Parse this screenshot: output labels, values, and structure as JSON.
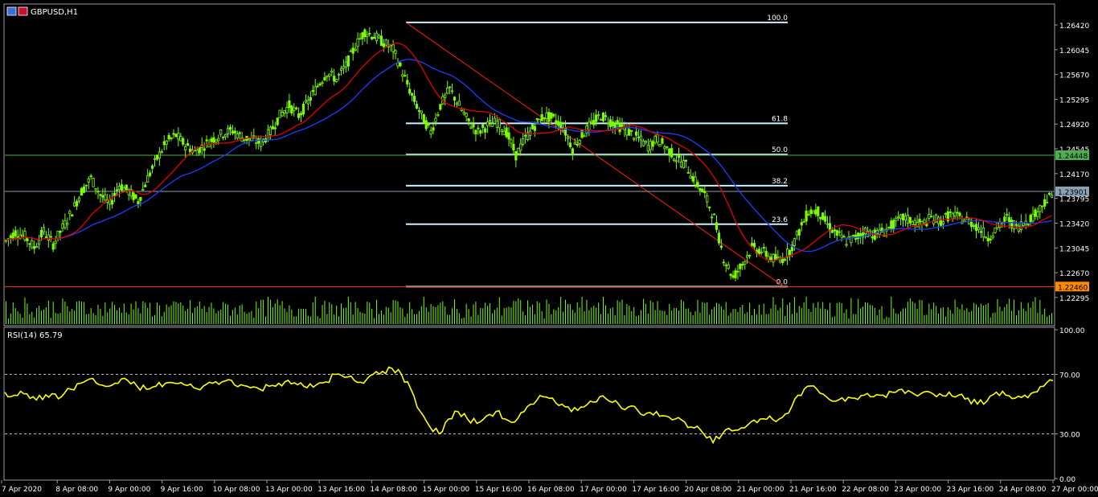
{
  "symbol_label": "GBPUSD,H1",
  "colors": {
    "candle": "#7CFC00",
    "ma_fast": "#e00000",
    "ma_slow": "#1e3cff",
    "fib": "#c6f2ff",
    "rsi": "#ffff00",
    "current_price_line": "#8aa0b4",
    "green_line": "#4caf50",
    "red_line": "#ff3b1f",
    "trend_line": "#ff2000"
  },
  "chart_data": [
    {
      "type": "candlestick",
      "title": "GBPUSD,H1",
      "ylim": [
        1.2205,
        1.267
      ],
      "price_ticks": [
        "1.26420",
        "1.26045",
        "1.25670",
        "1.25295",
        "1.24920",
        "1.24545",
        "1.24170",
        "1.23795",
        "1.23420",
        "1.23045",
        "1.22670",
        "1.22295"
      ],
      "x_ticks": [
        "7 Apr 2020",
        "8 Apr 08:00",
        "9 Apr 00:00",
        "9 Apr 16:00",
        "10 Apr 08:00",
        "13 Apr 00:00",
        "13 Apr 16:00",
        "14 Apr 08:00",
        "15 Apr 00:00",
        "15 Apr 16:00",
        "16 Apr 08:00",
        "17 Apr 00:00",
        "17 Apr 16:00",
        "20 Apr 08:00",
        "21 Apr 00:00",
        "21 Apr 16:00",
        "22 Apr 08:00",
        "23 Apr 00:00",
        "23 Apr 16:00",
        "24 Apr 08:00",
        "27 Apr 00:00"
      ],
      "close_path": [
        1.2315,
        1.2328,
        1.2322,
        1.2305,
        1.233,
        1.231,
        1.2335,
        1.236,
        1.239,
        1.241,
        1.2385,
        1.237,
        1.24,
        1.239,
        1.2375,
        1.241,
        1.244,
        1.2465,
        1.2475,
        1.246,
        1.245,
        1.246,
        1.247,
        1.2478,
        1.2482,
        1.2472,
        1.2468,
        1.2463,
        1.248,
        1.2505,
        1.252,
        1.2505,
        1.2525,
        1.255,
        1.257,
        1.256,
        1.258,
        1.261,
        1.2632,
        1.2625,
        1.2615,
        1.2605,
        1.257,
        1.2535,
        1.2505,
        1.248,
        1.252,
        1.2545,
        1.252,
        1.2495,
        1.248,
        1.249,
        1.2495,
        1.248,
        1.2445,
        1.247,
        1.249,
        1.2505,
        1.25,
        1.2488,
        1.2455,
        1.2475,
        1.2492,
        1.2505,
        1.2496,
        1.2488,
        1.248,
        1.247,
        1.2458,
        1.247,
        1.2455,
        1.244,
        1.243,
        1.2405,
        1.2385,
        1.235,
        1.229,
        1.226,
        1.228,
        1.2305,
        1.23,
        1.229,
        1.2285,
        1.23,
        1.233,
        1.236,
        1.236,
        1.234,
        1.2325,
        1.2315,
        1.232,
        1.233,
        1.2325,
        1.233,
        1.234,
        1.235,
        1.2345,
        1.234,
        1.235,
        1.2345,
        1.2355,
        1.235,
        1.2345,
        1.2335,
        1.232,
        1.2335,
        1.235,
        1.2335,
        1.2345,
        1.2355,
        1.2375,
        1.2385
      ],
      "ma_lag": [
        5,
        10
      ],
      "horizontal_lines": [
        {
          "price": 1.24448,
          "label": "1.24448",
          "color": "#4caf50",
          "label_bg": "#4caf50",
          "label_fg": "#000000"
        },
        {
          "price": 1.23901,
          "label": "1.23901",
          "color": "#8aa0b4",
          "label_bg": "#8aa0b4",
          "label_fg": "#000000"
        },
        {
          "price": 1.2246,
          "label": "1.22460",
          "color": "#ff3b1f",
          "label_bg": "#ff8a00",
          "label_fg": "#000000"
        }
      ],
      "fibonacci": {
        "high": 1.26458,
        "low": 1.2246,
        "levels": [
          {
            "level": 1.0,
            "label": "100.0"
          },
          {
            "level": 0.618,
            "label": "61.8"
          },
          {
            "level": 0.5,
            "label": "50.0"
          },
          {
            "level": 0.382,
            "label": "38.2"
          },
          {
            "level": 0.236,
            "label": "23.6"
          },
          {
            "level": 0.0,
            "label": "0.0"
          }
        ]
      }
    },
    {
      "type": "line",
      "title": "RSI(14) 65.79",
      "ylim": [
        0,
        100
      ],
      "y_ticks": [
        "100.00",
        "70.00",
        "30.00",
        "0.00"
      ],
      "levels": [
        70,
        30
      ],
      "values": [
        58,
        56,
        57,
        55,
        53,
        57,
        55,
        60,
        64,
        67,
        63,
        62,
        64,
        66,
        62,
        60,
        62,
        64,
        64,
        63,
        61,
        62,
        64,
        65,
        66,
        63,
        61,
        60,
        62,
        64,
        66,
        63,
        61,
        63,
        65,
        70,
        68,
        66,
        64,
        70,
        72,
        74,
        70,
        60,
        45,
        35,
        30,
        40,
        45,
        40,
        37,
        42,
        45,
        40,
        38,
        45,
        50,
        55,
        54,
        50,
        45,
        48,
        52,
        55,
        52,
        50,
        48,
        46,
        44,
        45,
        42,
        40,
        38,
        34,
        30,
        24,
        30,
        32,
        34,
        38,
        40,
        42,
        40,
        44,
        56,
        62,
        60,
        55,
        52,
        52,
        54,
        56,
        55,
        56,
        58,
        60,
        58,
        57,
        58,
        57,
        58,
        56,
        54,
        50,
        52,
        58,
        56,
        54,
        56,
        58,
        62,
        65.79
      ]
    }
  ]
}
